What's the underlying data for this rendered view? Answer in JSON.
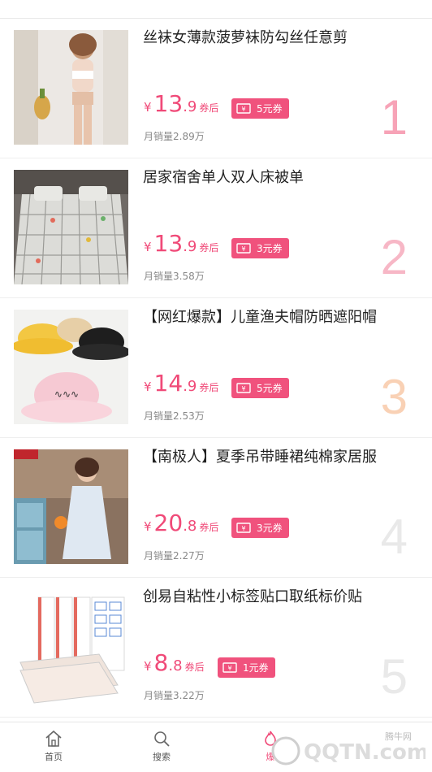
{
  "products": [
    {
      "title": "丝袜女薄款菠萝袜防勾丝任意剪",
      "currency": "¥",
      "price_int": "13",
      "price_dec": ".9",
      "after_label": "券后",
      "coupon": "5元券",
      "sales_label": "月销量",
      "sales": "2.89万",
      "rank": "1",
      "rank_color": "#f7a3b7"
    },
    {
      "title": "居家宿舍单人双人床被单",
      "currency": "¥",
      "price_int": "13",
      "price_dec": ".9",
      "after_label": "券后",
      "coupon": "3元券",
      "sales_label": "月销量",
      "sales": "3.58万",
      "rank": "2",
      "rank_color": "#f7b7c6"
    },
    {
      "title": "【网红爆款】儿童渔夫帽防晒遮阳帽",
      "currency": "¥",
      "price_int": "14",
      "price_dec": ".9",
      "after_label": "券后",
      "coupon": "5元券",
      "sales_label": "月销量",
      "sales": "2.53万",
      "rank": "3",
      "rank_color": "#f9d1b5"
    },
    {
      "title": "【南极人】夏季吊带睡裙纯棉家居服",
      "currency": "¥",
      "price_int": "20",
      "price_dec": ".8",
      "after_label": "券后",
      "coupon": "3元券",
      "sales_label": "月销量",
      "sales": "2.27万",
      "rank": "4",
      "rank_color": "#e9e9e9"
    },
    {
      "title": "创易自粘性小标签贴口取纸标价贴",
      "currency": "¥",
      "price_int": "8",
      "price_dec": ".8",
      "after_label": "券后",
      "coupon": "1元券",
      "sales_label": "月销量",
      "sales": "3.22万",
      "rank": "5",
      "rank_color": "#e9e9e9"
    }
  ],
  "tabs": {
    "home": "首页",
    "search": "搜索",
    "hot": "爆"
  },
  "watermark": {
    "brand": "腾牛网",
    "site": "QQTN.com"
  },
  "colors": {
    "accent": "#f04a78"
  }
}
